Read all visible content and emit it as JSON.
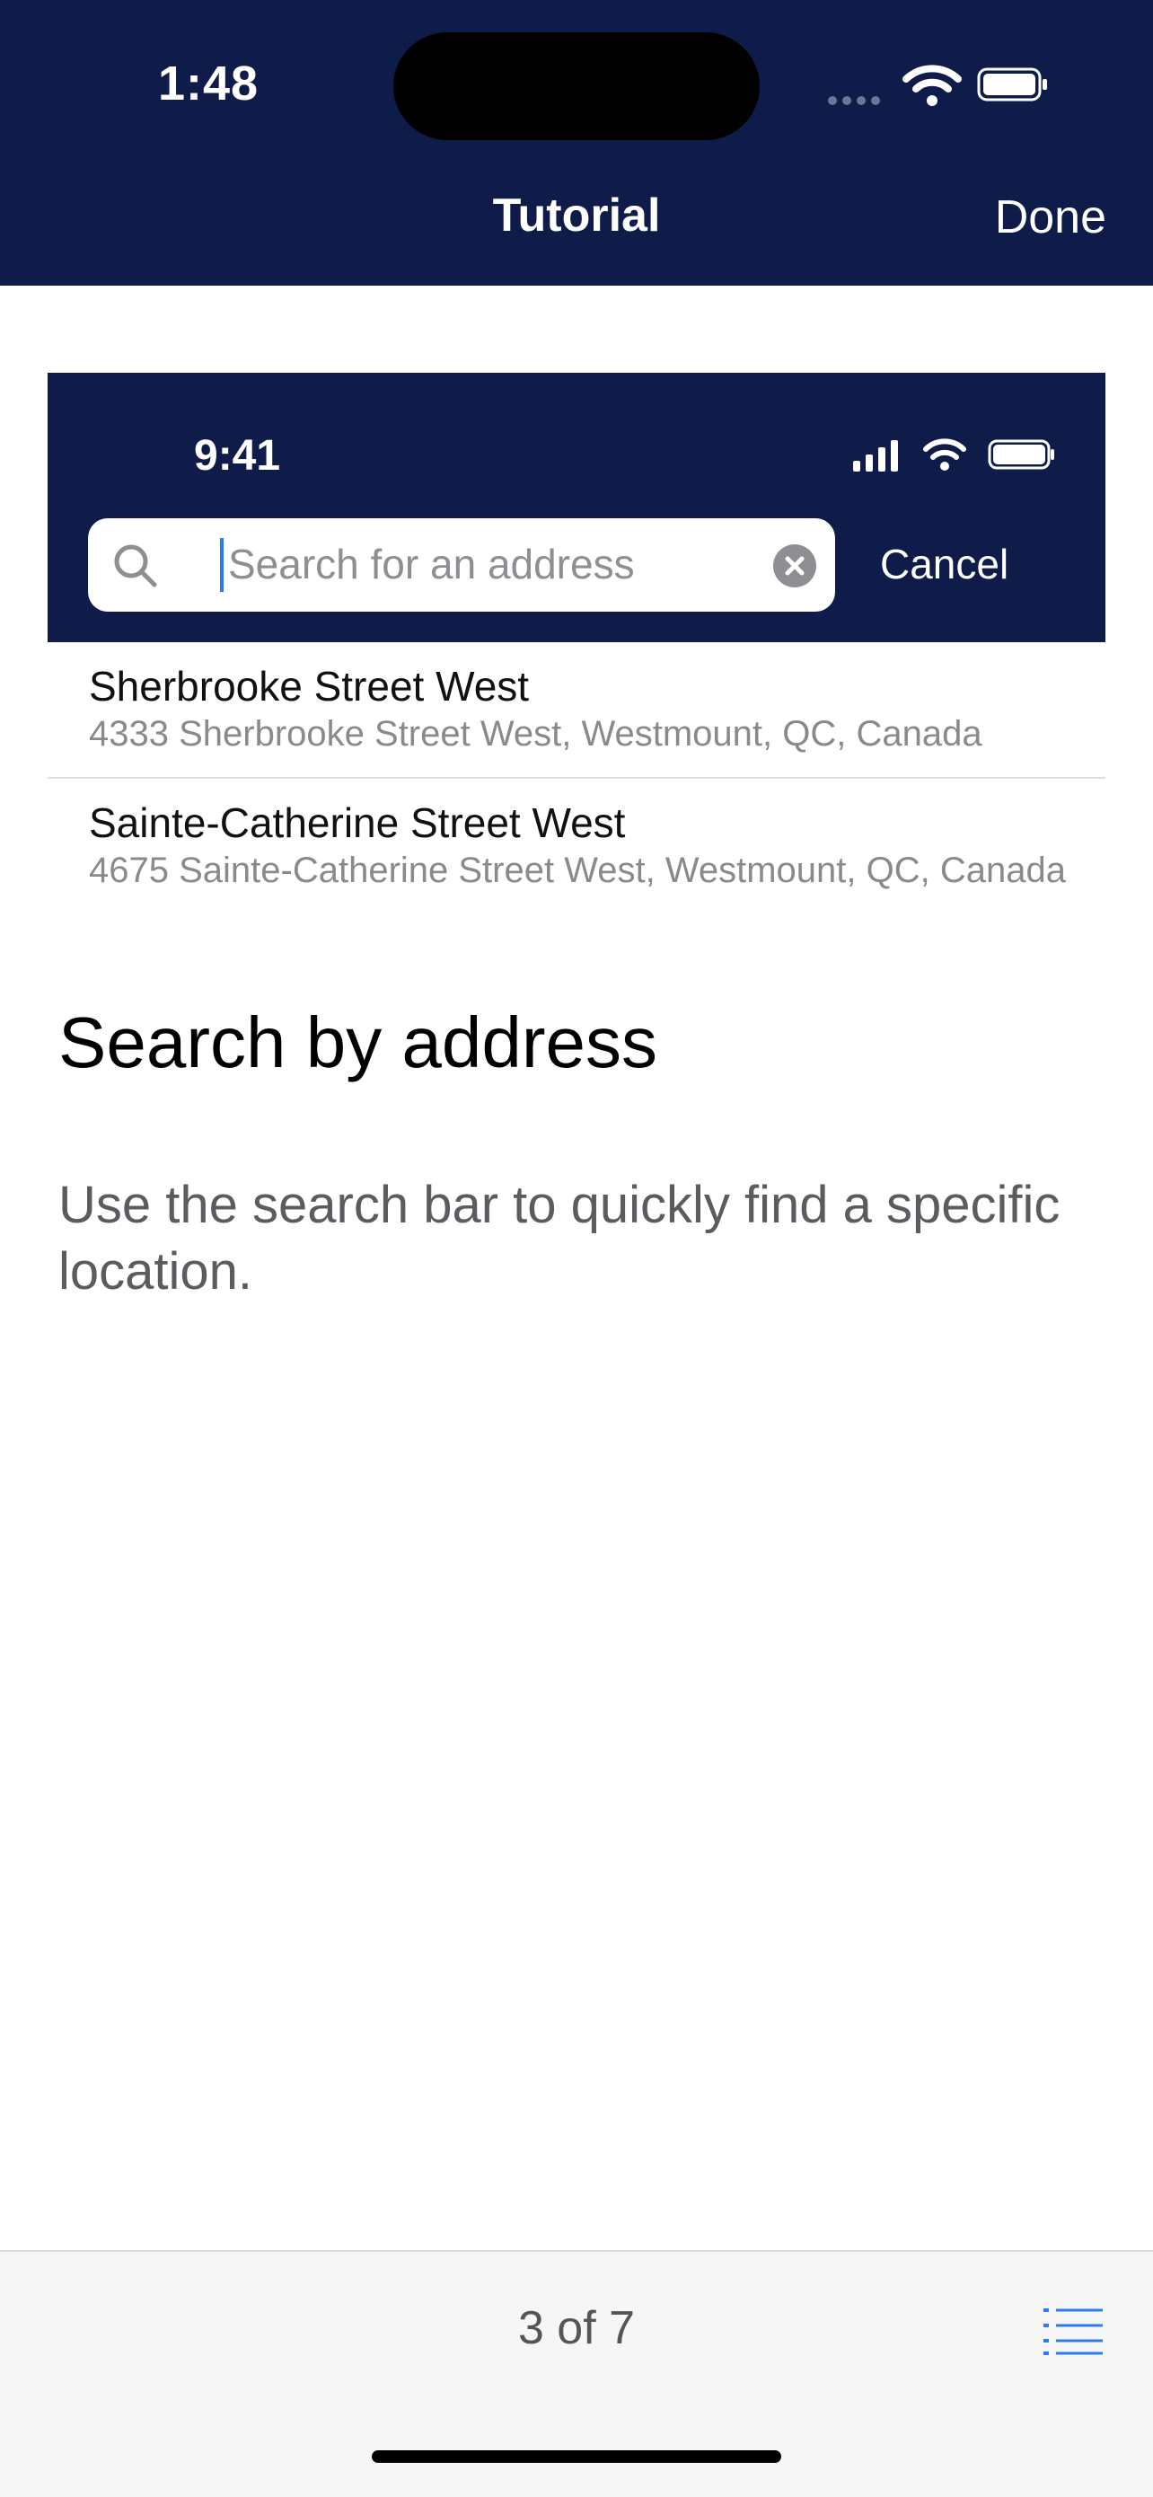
{
  "status_bar": {
    "time": "1:48"
  },
  "nav": {
    "title": "Tutorial",
    "done_label": "Done"
  },
  "preview": {
    "time": "9:41",
    "search": {
      "placeholder": "Search for an address",
      "cancel_label": "Cancel"
    },
    "results": [
      {
        "title": "Sherbrooke Street West",
        "subtitle": "4333 Sherbrooke Street West, Westmount, QC, Canada"
      },
      {
        "title": "Sainte-Catherine Street West",
        "subtitle": "4675 Sainte-Catherine Street West, Westmount, QC, Canada"
      }
    ]
  },
  "content": {
    "heading": "Search by address",
    "description": "Use the search bar to quickly find a specific location."
  },
  "footer": {
    "page_indicator": "3 of 7"
  },
  "icons": {
    "wifi": "wifi-icon",
    "battery": "battery-icon",
    "search": "search-icon",
    "clear": "clear-icon",
    "list": "list-icon"
  },
  "colors": {
    "navy": "#0f1c4a",
    "accent": "#2a7bf4"
  }
}
